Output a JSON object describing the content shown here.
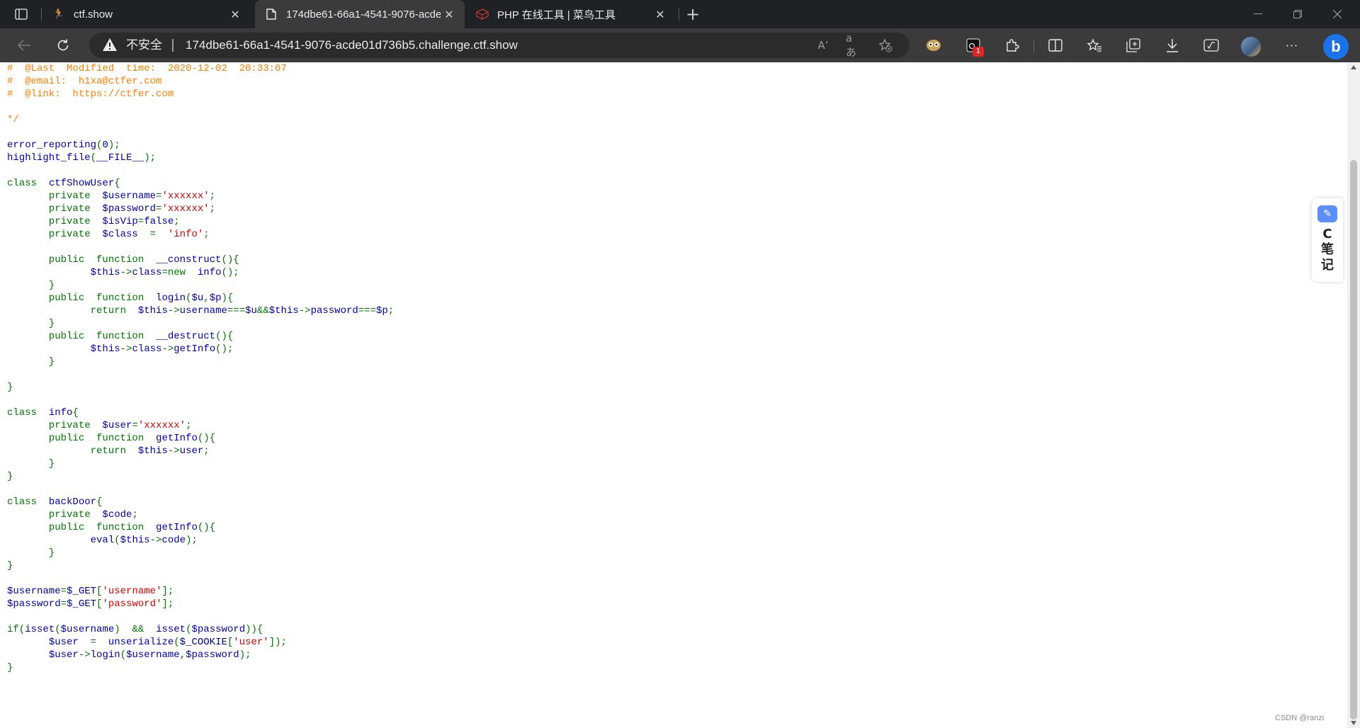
{
  "browser": {
    "tabs": [
      {
        "title": "ctf.show",
        "active": false,
        "icon": "running-person-icon"
      },
      {
        "title": "174dbe61-66a1-4541-9076-acde",
        "active": true,
        "icon": "page-icon"
      },
      {
        "title": "PHP 在线工具 | 菜鸟工具",
        "active": false,
        "icon": "runoob-cube-icon"
      }
    ],
    "close_glyph": "✕",
    "new_tab_glyph": "+",
    "address": {
      "security_label": "不安全",
      "url": "174dbe61-66a1-4541-9076-acde01d736b5.challenge.ctf.show",
      "read_aloud": "A’",
      "translate": "aあ"
    },
    "extension_badge": "1",
    "bing_label": "b",
    "more_glyph": "···"
  },
  "code_lines": [
    [
      {
        "t": "#  @Last  Modified  time:  2020-12-02  20:33:07",
        "c": "com"
      }
    ],
    [
      {
        "t": "#  @email:  h1xa@ctfer.com",
        "c": "com"
      }
    ],
    [
      {
        "t": "#  @link:  https://ctfer.com",
        "c": "com"
      }
    ],
    [],
    [
      {
        "t": "*/",
        "c": "com"
      }
    ],
    [],
    [
      {
        "t": "error_reporting",
        "c": "def"
      },
      {
        "t": "(",
        "c": "kw"
      },
      {
        "t": "0",
        "c": "def"
      },
      {
        "t": ");",
        "c": "kw"
      }
    ],
    [
      {
        "t": "highlight_file",
        "c": "def"
      },
      {
        "t": "(",
        "c": "kw"
      },
      {
        "t": "__FILE__",
        "c": "def"
      },
      {
        "t": ");",
        "c": "kw"
      }
    ],
    [],
    [
      {
        "t": "class  ",
        "c": "kw"
      },
      {
        "t": "ctfShowUser",
        "c": "def"
      },
      {
        "t": "{",
        "c": "kw"
      }
    ],
    [
      {
        "t": "       private  ",
        "c": "kw"
      },
      {
        "t": "$username",
        "c": "def"
      },
      {
        "t": "=",
        "c": "kw"
      },
      {
        "t": "'xxxxxx'",
        "c": "str"
      },
      {
        "t": ";",
        "c": "kw"
      }
    ],
    [
      {
        "t": "       private  ",
        "c": "kw"
      },
      {
        "t": "$password",
        "c": "def"
      },
      {
        "t": "=",
        "c": "kw"
      },
      {
        "t": "'xxxxxx'",
        "c": "str"
      },
      {
        "t": ";",
        "c": "kw"
      }
    ],
    [
      {
        "t": "       private  ",
        "c": "kw"
      },
      {
        "t": "$isVip",
        "c": "def"
      },
      {
        "t": "=",
        "c": "kw"
      },
      {
        "t": "false",
        "c": "def"
      },
      {
        "t": ";",
        "c": "kw"
      }
    ],
    [
      {
        "t": "       private  ",
        "c": "kw"
      },
      {
        "t": "$class  ",
        "c": "def"
      },
      {
        "t": "=  ",
        "c": "kw"
      },
      {
        "t": "'info'",
        "c": "str"
      },
      {
        "t": ";",
        "c": "kw"
      }
    ],
    [],
    [
      {
        "t": "       public  function  ",
        "c": "kw"
      },
      {
        "t": "__construct",
        "c": "def"
      },
      {
        "t": "(){",
        "c": "kw"
      }
    ],
    [
      {
        "t": "              ",
        "c": "kw"
      },
      {
        "t": "$this",
        "c": "def"
      },
      {
        "t": "->",
        "c": "kw"
      },
      {
        "t": "class",
        "c": "def"
      },
      {
        "t": "=new  ",
        "c": "kw"
      },
      {
        "t": "info",
        "c": "def"
      },
      {
        "t": "();",
        "c": "kw"
      }
    ],
    [
      {
        "t": "       }",
        "c": "kw"
      }
    ],
    [
      {
        "t": "       public  function  ",
        "c": "kw"
      },
      {
        "t": "login",
        "c": "def"
      },
      {
        "t": "(",
        "c": "kw"
      },
      {
        "t": "$u",
        "c": "def"
      },
      {
        "t": ",",
        "c": "kw"
      },
      {
        "t": "$p",
        "c": "def"
      },
      {
        "t": "){",
        "c": "kw"
      }
    ],
    [
      {
        "t": "              return  ",
        "c": "kw"
      },
      {
        "t": "$this",
        "c": "def"
      },
      {
        "t": "->",
        "c": "kw"
      },
      {
        "t": "username",
        "c": "def"
      },
      {
        "t": "===",
        "c": "kw"
      },
      {
        "t": "$u",
        "c": "def"
      },
      {
        "t": "&&",
        "c": "kw"
      },
      {
        "t": "$this",
        "c": "def"
      },
      {
        "t": "->",
        "c": "kw"
      },
      {
        "t": "password",
        "c": "def"
      },
      {
        "t": "===",
        "c": "kw"
      },
      {
        "t": "$p",
        "c": "def"
      },
      {
        "t": ";",
        "c": "kw"
      }
    ],
    [
      {
        "t": "       }",
        "c": "kw"
      }
    ],
    [
      {
        "t": "       public  function  ",
        "c": "kw"
      },
      {
        "t": "__destruct",
        "c": "def"
      },
      {
        "t": "(){",
        "c": "kw"
      }
    ],
    [
      {
        "t": "              ",
        "c": "kw"
      },
      {
        "t": "$this",
        "c": "def"
      },
      {
        "t": "->",
        "c": "kw"
      },
      {
        "t": "class",
        "c": "def"
      },
      {
        "t": "->",
        "c": "kw"
      },
      {
        "t": "getInfo",
        "c": "def"
      },
      {
        "t": "();",
        "c": "kw"
      }
    ],
    [
      {
        "t": "       }",
        "c": "kw"
      }
    ],
    [],
    [
      {
        "t": "}",
        "c": "kw"
      }
    ],
    [],
    [
      {
        "t": "class  ",
        "c": "kw"
      },
      {
        "t": "info",
        "c": "def"
      },
      {
        "t": "{",
        "c": "kw"
      }
    ],
    [
      {
        "t": "       private  ",
        "c": "kw"
      },
      {
        "t": "$user",
        "c": "def"
      },
      {
        "t": "=",
        "c": "kw"
      },
      {
        "t": "'xxxxxx'",
        "c": "str"
      },
      {
        "t": ";",
        "c": "kw"
      }
    ],
    [
      {
        "t": "       public  function  ",
        "c": "kw"
      },
      {
        "t": "getInfo",
        "c": "def"
      },
      {
        "t": "(){",
        "c": "kw"
      }
    ],
    [
      {
        "t": "              return  ",
        "c": "kw"
      },
      {
        "t": "$this",
        "c": "def"
      },
      {
        "t": "->",
        "c": "kw"
      },
      {
        "t": "user",
        "c": "def"
      },
      {
        "t": ";",
        "c": "kw"
      }
    ],
    [
      {
        "t": "       }",
        "c": "kw"
      }
    ],
    [
      {
        "t": "}",
        "c": "kw"
      }
    ],
    [],
    [
      {
        "t": "class  ",
        "c": "kw"
      },
      {
        "t": "backDoor",
        "c": "def"
      },
      {
        "t": "{",
        "c": "kw"
      }
    ],
    [
      {
        "t": "       private  ",
        "c": "kw"
      },
      {
        "t": "$code",
        "c": "def"
      },
      {
        "t": ";",
        "c": "kw"
      }
    ],
    [
      {
        "t": "       public  function  ",
        "c": "kw"
      },
      {
        "t": "getInfo",
        "c": "def"
      },
      {
        "t": "(){",
        "c": "kw"
      }
    ],
    [
      {
        "t": "              ",
        "c": "kw"
      },
      {
        "t": "eval",
        "c": "def"
      },
      {
        "t": "(",
        "c": "kw"
      },
      {
        "t": "$this",
        "c": "def"
      },
      {
        "t": "->",
        "c": "kw"
      },
      {
        "t": "code",
        "c": "def"
      },
      {
        "t": ");",
        "c": "kw"
      }
    ],
    [
      {
        "t": "       }",
        "c": "kw"
      }
    ],
    [
      {
        "t": "}",
        "c": "kw"
      }
    ],
    [],
    [
      {
        "t": "$username",
        "c": "def"
      },
      {
        "t": "=",
        "c": "kw"
      },
      {
        "t": "$_GET",
        "c": "def"
      },
      {
        "t": "[",
        "c": "kw"
      },
      {
        "t": "'username'",
        "c": "str"
      },
      {
        "t": "];",
        "c": "kw"
      }
    ],
    [
      {
        "t": "$password",
        "c": "def"
      },
      {
        "t": "=",
        "c": "kw"
      },
      {
        "t": "$_GET",
        "c": "def"
      },
      {
        "t": "[",
        "c": "kw"
      },
      {
        "t": "'password'",
        "c": "str"
      },
      {
        "t": "];",
        "c": "kw"
      }
    ],
    [],
    [
      {
        "t": "if(",
        "c": "kw"
      },
      {
        "t": "isset",
        "c": "def"
      },
      {
        "t": "(",
        "c": "kw"
      },
      {
        "t": "$username",
        "c": "def"
      },
      {
        "t": ")  &&  ",
        "c": "kw"
      },
      {
        "t": "isset",
        "c": "def"
      },
      {
        "t": "(",
        "c": "kw"
      },
      {
        "t": "$password",
        "c": "def"
      },
      {
        "t": ")){",
        "c": "kw"
      }
    ],
    [
      {
        "t": "       ",
        "c": "kw"
      },
      {
        "t": "$user  ",
        "c": "def"
      },
      {
        "t": "=  ",
        "c": "kw"
      },
      {
        "t": "unserialize",
        "c": "def"
      },
      {
        "t": "(",
        "c": "kw"
      },
      {
        "t": "$_COOKIE",
        "c": "def"
      },
      {
        "t": "[",
        "c": "kw"
      },
      {
        "t": "'user'",
        "c": "str"
      },
      {
        "t": "]);",
        "c": "kw"
      }
    ],
    [
      {
        "t": "       ",
        "c": "kw"
      },
      {
        "t": "$user",
        "c": "def"
      },
      {
        "t": "->",
        "c": "kw"
      },
      {
        "t": "login",
        "c": "def"
      },
      {
        "t": "(",
        "c": "kw"
      },
      {
        "t": "$username",
        "c": "def"
      },
      {
        "t": ",",
        "c": "kw"
      },
      {
        "t": "$password",
        "c": "def"
      },
      {
        "t": ");",
        "c": "kw"
      }
    ],
    [
      {
        "t": "}",
        "c": "kw"
      }
    ]
  ],
  "note_widget": {
    "label_c": "C",
    "label_1": "笔",
    "label_2": "记"
  },
  "watermark": "CSDN @ranzi",
  "colors": {
    "comment": "#ff8000",
    "keyword": "#007700",
    "string": "#dd0000",
    "default": "#0000bb"
  }
}
